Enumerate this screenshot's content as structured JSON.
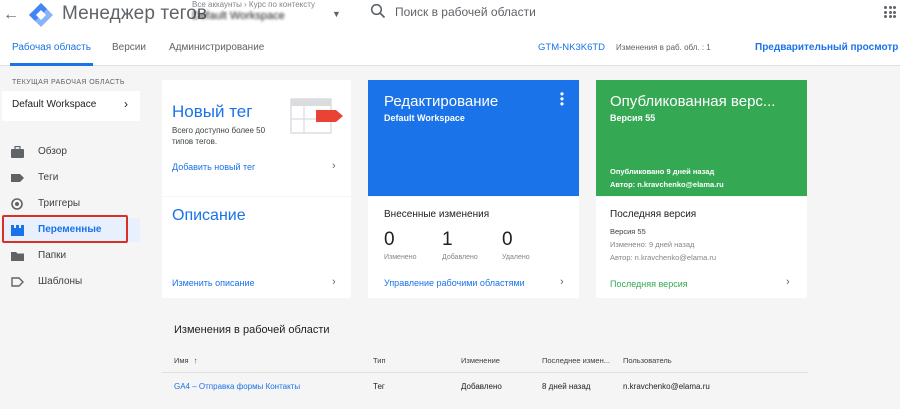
{
  "header": {
    "app_title": "Менеджер тегов",
    "account_crumb": "Все аккаунты › Курс по контексту",
    "workspace_name": "Default Workspace",
    "search_placeholder": "Поиск в рабочей области"
  },
  "tabs": [
    {
      "label": "Рабочая область",
      "active": true
    },
    {
      "label": "Версии",
      "active": false
    },
    {
      "label": "Администрирование",
      "active": false
    }
  ],
  "container_id": "GTM-NK3K6TD",
  "workspace_changes": "Изменения в раб. обл. : 1",
  "preview_label": "Предварительный просмотр",
  "sidebar": {
    "workspace_label": "ТЕКУЩАЯ РАБОЧАЯ ОБЛАСТЬ",
    "workspace_name": "Default Workspace",
    "items": [
      {
        "label": "Обзор",
        "icon": "briefcase-icon",
        "active": false
      },
      {
        "label": "Теги",
        "icon": "tag-icon",
        "active": false
      },
      {
        "label": "Триггеры",
        "icon": "trigger-icon",
        "active": false
      },
      {
        "label": "Переменные",
        "icon": "variables-icon",
        "active": true
      },
      {
        "label": "Папки",
        "icon": "folder-icon",
        "active": false
      },
      {
        "label": "Шаблоны",
        "icon": "template-icon",
        "active": false
      }
    ]
  },
  "new_tag": {
    "title": "Новый тег",
    "subtitle": "Всего доступно более 50 типов тегов.",
    "link": "Добавить новый тег"
  },
  "description": {
    "title": "Описание",
    "link": "Изменить описание"
  },
  "editing": {
    "title": "Редактирование",
    "subtitle": "Default Workspace"
  },
  "published": {
    "title": "Опубликованная верс...",
    "subtitle": "Версия 55",
    "published_ago": "Опубликовано 9 дней назад",
    "author": "Автор: n.kravchenko@elama.ru"
  },
  "changes": {
    "title": "Внесенные изменения",
    "stats": [
      {
        "value": "0",
        "label": "Изменено"
      },
      {
        "value": "1",
        "label": "Добавлено"
      },
      {
        "value": "0",
        "label": "Удалено"
      }
    ],
    "link": "Управление рабочими областями"
  },
  "latest_version": {
    "title": "Последняя версия",
    "version": "Версия 55",
    "changed": "Изменено: 9 дней назад",
    "author": "Автор: n.kravchenko@elama.ru",
    "link": "Последняя версия"
  },
  "changes_table": {
    "title": "Изменения в рабочей области",
    "headers": {
      "name": "Имя",
      "type": "Тип",
      "change": "Изменение",
      "last_changed": "Последнее измен...",
      "user": "Пользователь"
    },
    "rows": [
      {
        "name": "GA4 – Отправка формы Контакты",
        "type": "Тег",
        "change": "Добавлено",
        "last_changed": "8 дней назад",
        "user": "n.kravchenko@elama.ru"
      }
    ]
  },
  "colors": {
    "accent": "#1a73e8",
    "published": "#34a853",
    "highlight": "#d93025"
  }
}
